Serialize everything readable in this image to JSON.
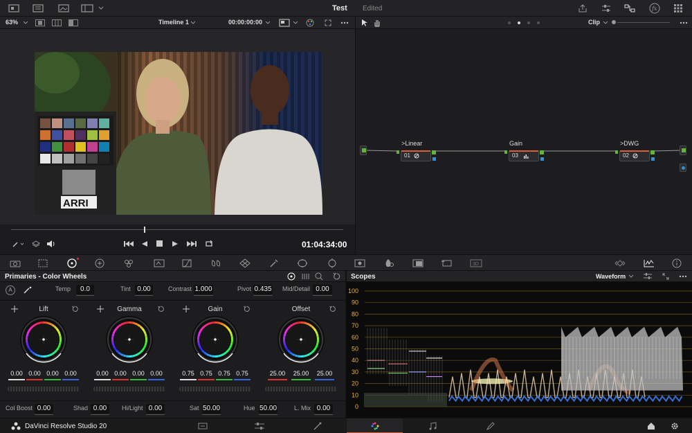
{
  "project": {
    "name": "Test",
    "state": "Edited"
  },
  "viewer": {
    "zoom": "63%",
    "timeline_name": "Timeline 1",
    "timecode_top": "00:00:00:00",
    "timecode_bottom": "01:04:34:00",
    "playhead_percent": 40,
    "chart_brand": "ARRI"
  },
  "nodes": {
    "mode": "Clip",
    "items": [
      {
        "label": ">Linear",
        "num": "01"
      },
      {
        "label": "Gain",
        "num": "03"
      },
      {
        "label": ">DWG",
        "num": "02"
      }
    ]
  },
  "primaries": {
    "title": "Primaries - Color Wheels",
    "top_params": [
      {
        "label": "Temp",
        "value": "0.0"
      },
      {
        "label": "Tint",
        "value": "0.00"
      },
      {
        "label": "Contrast",
        "value": "1.000"
      },
      {
        "label": "Pivot",
        "value": "0.435"
      },
      {
        "label": "Mid/Detail",
        "value": "0.00"
      }
    ],
    "wheels": [
      {
        "name": "Lift",
        "values": [
          "0.00",
          "0.00",
          "0.00",
          "0.00"
        ]
      },
      {
        "name": "Gamma",
        "values": [
          "0.00",
          "0.00",
          "0.00",
          "0.00"
        ]
      },
      {
        "name": "Gain",
        "values": [
          "0.75",
          "0.75",
          "0.75",
          "0.75"
        ]
      },
      {
        "name": "Offset",
        "values": [
          "25.00",
          "25.00",
          "25.00"
        ]
      }
    ],
    "bottom_params": [
      {
        "label": "Col Boost",
        "value": "0.00"
      },
      {
        "label": "Shad",
        "value": "0.00"
      },
      {
        "label": "Hi/Light",
        "value": "0.00"
      },
      {
        "label": "Sat",
        "value": "50.00"
      },
      {
        "label": "Hue",
        "value": "50.00"
      },
      {
        "label": "L. Mix",
        "value": "0.00"
      }
    ]
  },
  "scopes": {
    "title": "Scopes",
    "mode": "Waveform",
    "ticks": [
      "100",
      "90",
      "80",
      "70",
      "60",
      "50",
      "40",
      "30",
      "20",
      "10",
      "0"
    ]
  },
  "footer": {
    "brand": "DaVinci Resolve Studio 20"
  },
  "colors": {
    "accent_orange": "#d5603a",
    "scope_tick": "#f0b030",
    "node_port": "#62b33a"
  }
}
